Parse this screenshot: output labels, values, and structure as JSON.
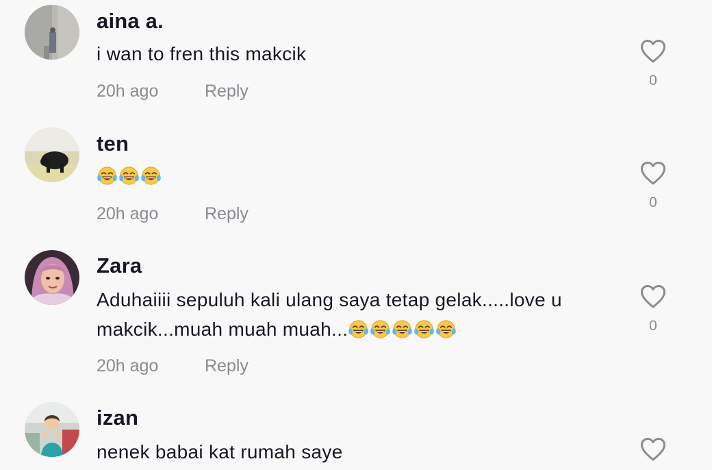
{
  "comments": [
    {
      "username": "aina a.",
      "text": "i wan to fren this makcik",
      "time": "20h ago",
      "reply_label": "Reply",
      "likes": "0",
      "emoji_count": 0
    },
    {
      "username": "ten",
      "text": "",
      "time": "20h ago",
      "reply_label": "Reply",
      "likes": "0",
      "emoji_count": 3
    },
    {
      "username": "Zara",
      "text": "Aduhaiiii sepuluh kali ulang saya tetap gelak.....love u makcik...muah muah muah...",
      "time": "20h ago",
      "reply_label": "Reply",
      "likes": "0",
      "emoji_count": 5
    },
    {
      "username": "izan",
      "text": "nenek babai kat rumah saye",
      "time": "",
      "reply_label": "",
      "likes": "",
      "emoji_count": 0
    }
  ],
  "icons": {
    "like": "heart-outline-icon",
    "emoji": "face-with-tears-of-joy-emoji"
  },
  "colors": {
    "background": "#f8f8f8",
    "username": "#161823",
    "meta": "#8a8b91",
    "heart_stroke": "#8a8b91"
  }
}
